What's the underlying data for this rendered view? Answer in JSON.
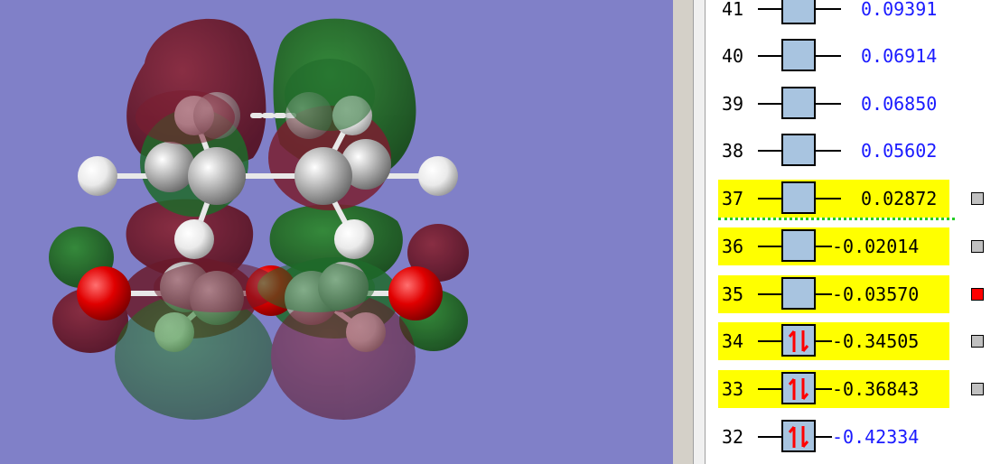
{
  "viewer": {
    "background_color": "#8080c8",
    "lobe_colors": {
      "positive": "#1e5e1e",
      "negative": "#6e1a2a"
    },
    "atom_colors": {
      "carbon": "#a6a6a6",
      "hydrogen": "#f2f2f2",
      "oxygen": "#e00000"
    }
  },
  "orbitals": [
    {
      "num": "41",
      "energy": "0.09391",
      "occupied": false,
      "highlighted": false,
      "swatch": null
    },
    {
      "num": "40",
      "energy": "0.06914",
      "occupied": false,
      "highlighted": false,
      "swatch": null
    },
    {
      "num": "39",
      "energy": "0.06850",
      "occupied": false,
      "highlighted": false,
      "swatch": null
    },
    {
      "num": "38",
      "energy": "0.05602",
      "occupied": false,
      "highlighted": false,
      "swatch": null
    },
    {
      "num": "37",
      "energy": "0.02872",
      "occupied": false,
      "highlighted": true,
      "swatch": "#c0c0c0"
    },
    {
      "num": "36",
      "energy": "-0.02014",
      "occupied": false,
      "highlighted": true,
      "swatch": "#c0c0c0"
    },
    {
      "num": "35",
      "energy": "-0.03570",
      "occupied": false,
      "highlighted": true,
      "swatch": "#ff0000"
    },
    {
      "num": "34",
      "energy": "-0.34505",
      "occupied": true,
      "highlighted": true,
      "swatch": "#c0c0c0"
    },
    {
      "num": "33",
      "energy": "-0.36843",
      "occupied": true,
      "highlighted": true,
      "swatch": "#c0c0c0"
    },
    {
      "num": "32",
      "energy": "-0.42334",
      "occupied": true,
      "highlighted": false,
      "swatch": null
    }
  ],
  "colors": {
    "highlight": "#ffff00",
    "box_fill": "#a8c4e0",
    "electron_arrows": "#ff0000",
    "energy_text": "#1a1aff",
    "gap_marker": "#22cc22"
  }
}
